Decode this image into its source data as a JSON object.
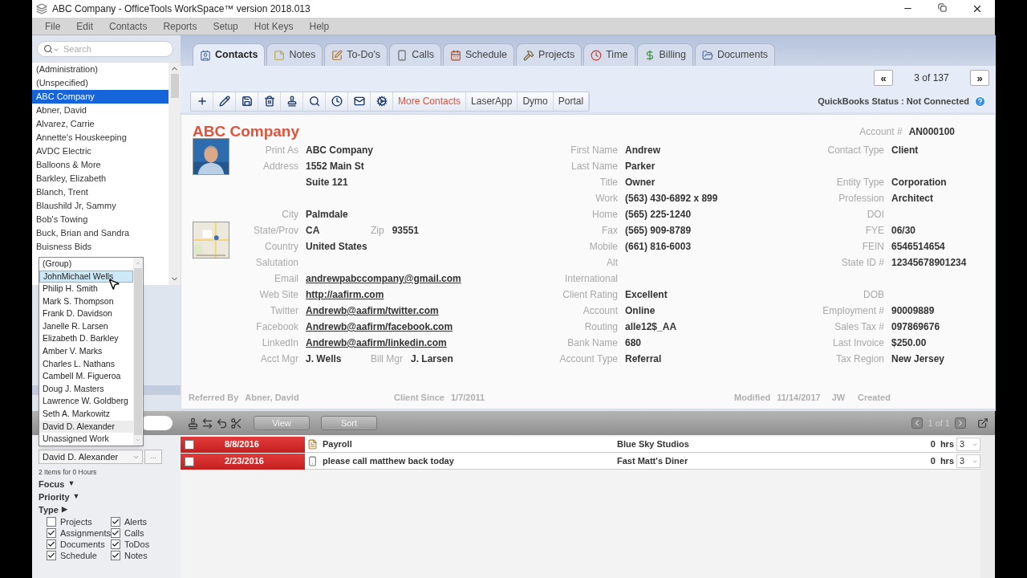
{
  "window": {
    "title": "ABC Company - OfficeTools WorkSpace™ version 2018.013"
  },
  "menu": [
    "File",
    "Edit",
    "Contacts",
    "Reports",
    "Setup",
    "Hot Keys",
    "Help"
  ],
  "sidebar": {
    "search": {
      "placeholder": "Search"
    },
    "items": [
      {
        "label": "(Administration)",
        "selected": false
      },
      {
        "label": "(Unspecified)",
        "selected": false
      },
      {
        "label": "ABC Company",
        "selected": true
      },
      {
        "label": "Abner, David",
        "selected": false
      },
      {
        "label": "Alvarez, Carrie",
        "selected": false
      },
      {
        "label": "Annette's Houskeeping",
        "selected": false
      },
      {
        "label": "AVDC Electric",
        "selected": false
      },
      {
        "label": "Balloons & More",
        "selected": false
      },
      {
        "label": "Barkley, Elizabeth",
        "selected": false
      },
      {
        "label": "Blanch, Trent",
        "selected": false
      },
      {
        "label": "Blaushild Jr, Sammy",
        "selected": false
      },
      {
        "label": "Bob's Towing",
        "selected": false
      },
      {
        "label": "Buck, Brian and Sandra",
        "selected": false
      },
      {
        "label": "Buisness Bids",
        "selected": false
      }
    ]
  },
  "tabs": [
    {
      "label": "Contacts",
      "kind": "contacts",
      "selected": true
    },
    {
      "label": "Notes",
      "kind": "notes",
      "selected": false
    },
    {
      "label": "To-Do's",
      "kind": "todos",
      "selected": false
    },
    {
      "label": "Calls",
      "kind": "calls",
      "selected": false
    },
    {
      "label": "Schedule",
      "kind": "schedule",
      "selected": false
    },
    {
      "label": "Projects",
      "kind": "projects",
      "selected": false
    },
    {
      "label": "Time",
      "kind": "time",
      "selected": false
    },
    {
      "label": "Billing",
      "kind": "billing",
      "selected": false
    },
    {
      "label": "Documents",
      "kind": "documents",
      "selected": false
    }
  ],
  "navigator": {
    "prev": "«",
    "position": "3 of 137",
    "next": "»"
  },
  "toolbar_buttons": [
    {
      "label": "More Contacts",
      "color": "#e0523b"
    },
    {
      "label": "LaserApp",
      "color": "#444444"
    },
    {
      "label": "Dymo",
      "color": "#444444"
    },
    {
      "label": "Portal",
      "color": "#444444"
    }
  ],
  "quickbooks_status": "QuickBooks Status : Not Connected",
  "contact": {
    "name": "ABC Company",
    "account": {
      "label": "Account #",
      "value": "AN000100"
    },
    "columns": [
      [
        {
          "kind": "text",
          "label": "Print As",
          "value": "ABC Company"
        },
        {
          "kind": "text",
          "label": "Address",
          "value": "1552 Main St"
        },
        {
          "kind": "text",
          "value": "Suite 121"
        },
        {
          "kind": "blank"
        },
        {
          "kind": "text",
          "label": "City",
          "value": "Palmdale"
        },
        {
          "kind": "text",
          "label": "State/Prov",
          "value": "CA",
          "extra": {
            "label": "Zip",
            "value": "93551"
          }
        },
        {
          "kind": "text",
          "label": "Country",
          "value": "United States"
        },
        {
          "kind": "text",
          "label": "Salutation"
        },
        {
          "kind": "link",
          "label": "Email",
          "value": "andrewpabccompany@gmail.com"
        },
        {
          "kind": "link",
          "label": "Web Site",
          "value": "http://aafirm.com"
        },
        {
          "kind": "link",
          "label": "Twitter",
          "value": "Andrewb@aafirm/twitter.com"
        },
        {
          "kind": "link",
          "label": "Facebook",
          "value": "Andrewb@aafirm/facebook.com"
        },
        {
          "kind": "link",
          "label": "LinkedIn",
          "value": "Andrewb@aafirm/linkedin.com"
        },
        {
          "kind": "text",
          "label": "Acct Mgr",
          "value": "J. Wells",
          "extra": {
            "label": "Bill Mgr",
            "value": "J. Larsen"
          }
        }
      ],
      [
        {
          "kind": "text",
          "label": "First Name",
          "value": "Andrew"
        },
        {
          "kind": "text",
          "label": "Last Name",
          "value": "Parker"
        },
        {
          "kind": "text",
          "label": "Title",
          "value": "Owner"
        },
        {
          "kind": "text",
          "label": "Work",
          "value": "(563) 430-6892  x 899"
        },
        {
          "kind": "text",
          "label": "Home",
          "value": "(565) 225-1240"
        },
        {
          "kind": "text",
          "label": "Fax",
          "value": "(565) 909-8789"
        },
        {
          "kind": "text",
          "label": "Mobile",
          "value": "(661) 816-6003"
        },
        {
          "kind": "text",
          "label": "Alt"
        },
        {
          "kind": "text",
          "label": "International"
        },
        {
          "kind": "text",
          "label": "Client Rating",
          "value": "Excellent"
        },
        {
          "kind": "text",
          "label": "Account",
          "value": "Online"
        },
        {
          "kind": "text",
          "label": "Routing",
          "value": "alle12$_AA"
        },
        {
          "kind": "text",
          "label": "Bank Name",
          "value": "680"
        },
        {
          "kind": "text",
          "label": "Account Type",
          "value": "Referral"
        }
      ],
      [
        {
          "kind": "text",
          "label": "Contact Type",
          "value": "Client"
        },
        {
          "kind": "blank"
        },
        {
          "kind": "text",
          "label": "Entity Type",
          "value": "Corporation"
        },
        {
          "kind": "text",
          "label": "Profession",
          "value": "Architect"
        },
        {
          "kind": "text",
          "label": "DOI"
        },
        {
          "kind": "text",
          "label": "FYE",
          "value": "06/30"
        },
        {
          "kind": "text",
          "label": "FEIN",
          "value": "6546514654"
        },
        {
          "kind": "text",
          "label": "State ID #",
          "value": "12345678901234"
        },
        {
          "kind": "blank"
        },
        {
          "kind": "text",
          "label": "DOB"
        },
        {
          "kind": "text",
          "label": "Employment #",
          "value": "90009889"
        },
        {
          "kind": "text",
          "label": "Sales Tax #",
          "value": "097869676"
        },
        {
          "kind": "text",
          "label": "Last Invoice",
          "value": "$250.00"
        },
        {
          "kind": "text",
          "label": "Tax Region",
          "value": "New Jersey"
        }
      ]
    ],
    "footer": [
      {
        "label": "Referred By",
        "value": "Abner, David"
      },
      {
        "label": "Client Since",
        "value": "1/7/2011"
      },
      {
        "label": "Modified",
        "value": "11/14/2017",
        "extra": "JW"
      },
      {
        "label": "Created"
      }
    ]
  },
  "task_toolbar": {
    "buttons": [
      "View",
      "Sort"
    ],
    "page": "1 of 1"
  },
  "tasks": [
    {
      "checked": false,
      "date": "8/8/2016",
      "kind": "todo",
      "title": "Payroll",
      "company": "Blue Sky Studios",
      "hours": "0",
      "unit": "hrs",
      "priority": "3"
    },
    {
      "checked": false,
      "date": "2/23/2016",
      "kind": "call",
      "title": "please call matthew back today",
      "company": "Fast Matt's Diner",
      "hours": "0",
      "unit": "hrs",
      "priority": "3"
    }
  ],
  "filters": {
    "assignee": "David D. Alexander",
    "more": "...",
    "summary": "2 Items for 0 Hours",
    "sections": [
      {
        "label": "Focus",
        "arrow": "▼"
      },
      {
        "label": "Priority",
        "arrow": "▼"
      },
      {
        "label": "Type",
        "arrow": "▶"
      }
    ],
    "types": [
      {
        "label": "Projects",
        "checked": false
      },
      {
        "label": "Alerts",
        "checked": true
      },
      {
        "label": "Assignments",
        "checked": true
      },
      {
        "label": "Calls",
        "checked": true
      },
      {
        "label": "Documents",
        "checked": true
      },
      {
        "label": "ToDos",
        "checked": true
      },
      {
        "label": "Schedule",
        "checked": true
      },
      {
        "label": "Notes",
        "checked": true
      }
    ]
  },
  "assignee_dropdown": {
    "items": [
      {
        "label": "(Group)",
        "selected": false,
        "current": false
      },
      {
        "label": "JohnMichael Wells",
        "selected": true,
        "current": false
      },
      {
        "label": "Philip H. Smith",
        "selected": false,
        "current": false
      },
      {
        "label": "Mark S. Thompson",
        "selected": false,
        "current": false
      },
      {
        "label": "Frank D. Davidson",
        "selected": false,
        "current": false
      },
      {
        "label": "Janelle R. Larsen",
        "selected": false,
        "current": false
      },
      {
        "label": "Elizabeth D. Barkley",
        "selected": false,
        "current": false
      },
      {
        "label": "Amber V. Marks",
        "selected": false,
        "current": false
      },
      {
        "label": "Charles L. Nathans",
        "selected": false,
        "current": false
      },
      {
        "label": "Cambell M. Figueroa",
        "selected": false,
        "current": false
      },
      {
        "label": "Doug  J. Masters",
        "selected": false,
        "current": false
      },
      {
        "label": "Lawrence W. Goldberg",
        "selected": false,
        "current": false
      },
      {
        "label": "Seth A. Markowitz",
        "selected": false,
        "current": false
      },
      {
        "label": "David D. Alexander",
        "selected": false,
        "current": true
      },
      {
        "label": "Unassigned  Work",
        "selected": false,
        "current": false
      }
    ]
  }
}
